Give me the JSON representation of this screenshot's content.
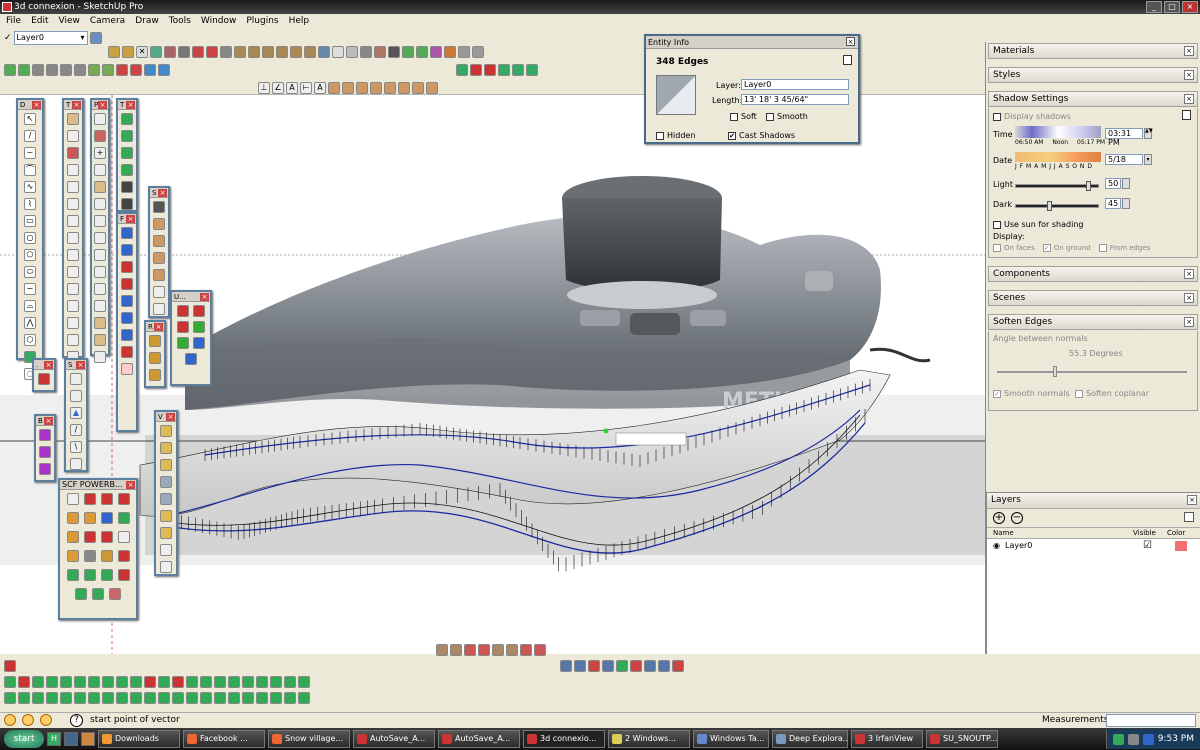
{
  "window": {
    "title": "3d connexion - SketchUp Pro",
    "buttons": [
      "_",
      "□",
      "×"
    ]
  },
  "menu": [
    "File",
    "Edit",
    "View",
    "Camera",
    "Draw",
    "Tools",
    "Window",
    "Plugins",
    "Help"
  ],
  "layer_toolbar": {
    "selected": "Layer0"
  },
  "entity_info": {
    "title": "Entity Info",
    "heading": "348 Edges",
    "layer_label": "Layer:",
    "layer_value": "Layer0",
    "length_label": "Length:",
    "length_value": "13' 18' 3 45/64\"",
    "soft_label": "Soft",
    "smooth_label": "Smooth",
    "hidden_label": "Hidden",
    "cast_shadows_label": "Cast Shadows",
    "cast_shadows_checked": "✔"
  },
  "tray": {
    "materials": "Materials",
    "styles": "Styles",
    "shadow": {
      "title": "Shadow Settings",
      "display_shadows": "Display shadows",
      "time_label": "Time",
      "time_start": "06:50 AM",
      "time_noon": "Noon",
      "time_end": "05:17 PM",
      "time_value": "03:31 PM",
      "date_label": "Date",
      "months": "J F M A M J J A S O N D",
      "date_value": "5/18",
      "light_label": "Light",
      "light_value": "50",
      "light_level": 0.9,
      "dark_label": "Dark",
      "dark_value": "45",
      "dark_level": 0.4,
      "use_sun": "Use sun for shading",
      "display_label": "Display:",
      "on_faces": "On faces",
      "on_ground": "On ground",
      "from_edges": "From edges"
    },
    "components": "Components",
    "scenes": "Scenes",
    "soften": {
      "title": "Soften Edges",
      "angle_label": "Angle between normals",
      "angle_value": "55.3",
      "degrees": "Degrees",
      "smooth_normals": "Smooth normals",
      "soften_coplanar": "Soften coplanar",
      "slider_level": 0.3
    }
  },
  "layers": {
    "title": "Layers",
    "col_name": "Name",
    "col_visible": "Visible",
    "col_color": "Color",
    "rows": [
      {
        "name": "Layer0",
        "visible": "☑",
        "color": "#f07070"
      }
    ]
  },
  "scf_window": {
    "title": "SCF POWERB..."
  },
  "status": {
    "hint": "start point of vector",
    "measurements_label": "Measurements"
  },
  "taskbar": {
    "start": "start",
    "buttons": [
      "Downloads",
      "Facebook ...",
      "Snow village...",
      "AutoSave_A...",
      "AutoSave_A...",
      "3d connexio...",
      "2 Windows...",
      "Windows Ta...",
      "Deep Explora...",
      "3 IrfanView",
      "SU_SNOUTP..."
    ],
    "time": "9:53 PM"
  },
  "colors": {
    "accent": "#5c7fa0",
    "edges": "#1a2aa0",
    "model": "#6e7478"
  }
}
